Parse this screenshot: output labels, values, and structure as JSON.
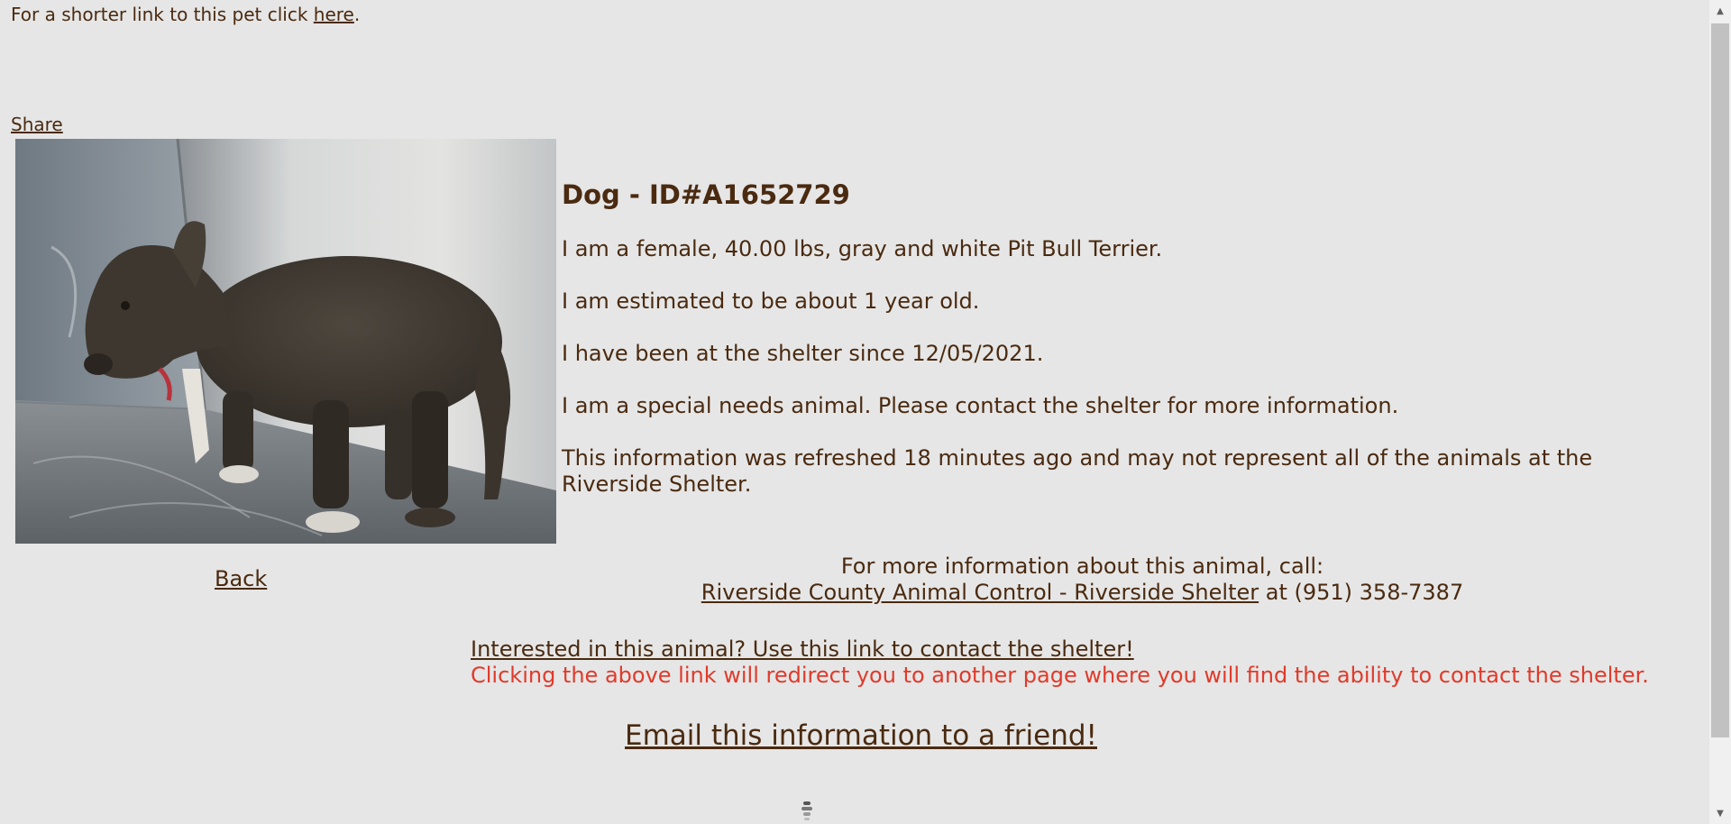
{
  "shorter_link": {
    "prefix": "For a shorter link to this pet click ",
    "link_text": "here",
    "suffix": "."
  },
  "share_label": "Share",
  "photo": {
    "alt": "Gray and white Pit Bull Terrier in a steel kennel"
  },
  "back_label": "Back",
  "animal": {
    "heading": "Dog - ID#A1652729",
    "description": "I am a female, 40.00 lbs, gray and white Pit Bull Terrier.",
    "age": "I am estimated to be about 1 year old.",
    "since": "I have been at the shelter since 12/05/2021.",
    "special_needs": "I am a special needs animal. Please contact the shelter for more information.",
    "refreshed": "This information was refreshed 18 minutes ago and may not represent all of the animals at the Riverside Shelter."
  },
  "call": {
    "line1": "For more information about this animal, call:",
    "shelter_link": "Riverside County Animal Control - Riverside Shelter",
    "phone_text": " at (951) 358-7387"
  },
  "contact": {
    "link_text": "Interested in this animal? Use this link to contact the shelter!",
    "note": "Clicking the above link will redirect you to another page where you will find the ability to contact the shelter."
  },
  "email_label": "Email this information to a friend!",
  "icons": {
    "loading": "loading-spinner-icon",
    "scroll_up": "scroll-up-arrow-icon",
    "scroll_down": "scroll-down-arrow-icon"
  },
  "colors": {
    "background": "#e6e6e6",
    "text": "#4a2a10",
    "warning": "#e03a2a"
  }
}
